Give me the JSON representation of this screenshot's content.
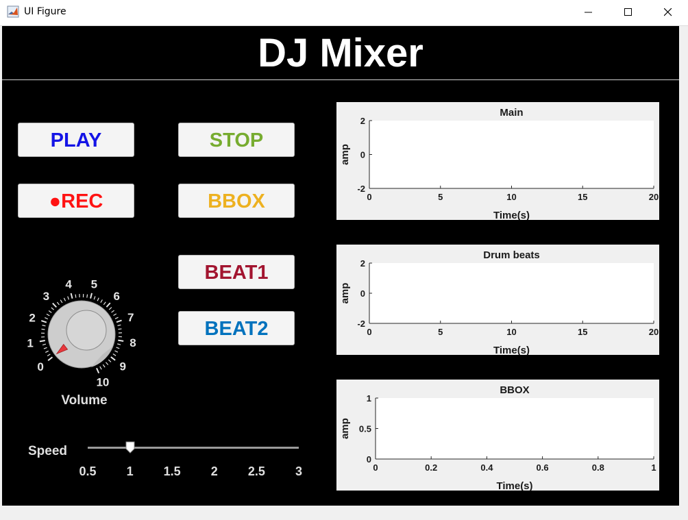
{
  "window": {
    "title": "UI Figure",
    "icon": "matlab-icon",
    "controls": [
      "minimize-icon",
      "maximize-icon",
      "close-icon"
    ]
  },
  "header": {
    "title": "DJ Mixer"
  },
  "buttons": {
    "play": {
      "label": "PLAY",
      "color": "#1414e6"
    },
    "stop": {
      "label": "STOP",
      "color": "#77ac30"
    },
    "rec": {
      "label": "●REC",
      "color": "#ff1212"
    },
    "bbox": {
      "label": "BBOX",
      "color": "#edb120"
    },
    "beat1": {
      "label": "BEAT1",
      "color": "#a2142f"
    },
    "beat2": {
      "label": "BEAT2",
      "color": "#0072bd"
    }
  },
  "volume_knob": {
    "label": "Volume",
    "ticks": [
      "0",
      "1",
      "2",
      "3",
      "4",
      "5",
      "6",
      "7",
      "8",
      "9",
      "10"
    ],
    "min": 0,
    "max": 10,
    "value": 0
  },
  "speed_slider": {
    "label": "Speed",
    "ticks": [
      "0.5",
      "1",
      "1.5",
      "2",
      "2.5",
      "3"
    ],
    "min": 0.5,
    "max": 3,
    "value": 1
  },
  "plots": [
    {
      "title": "Main",
      "xlabel": "Time(s)",
      "ylabel": "amp",
      "xlim": [
        0,
        20
      ],
      "ylim": [
        -2,
        2
      ],
      "xticks": [
        "0",
        "5",
        "10",
        "15",
        "20"
      ],
      "yticks": [
        "2",
        "0",
        "-2"
      ]
    },
    {
      "title": "Drum beats",
      "xlabel": "Time(s)",
      "ylabel": "amp",
      "xlim": [
        0,
        20
      ],
      "ylim": [
        -2,
        2
      ],
      "xticks": [
        "0",
        "5",
        "10",
        "15",
        "20"
      ],
      "yticks": [
        "2",
        "0",
        "-2"
      ]
    },
    {
      "title": "BBOX",
      "xlabel": "Time(s)",
      "ylabel": "amp",
      "xlim": [
        0,
        1
      ],
      "ylim": [
        0,
        1
      ],
      "xticks": [
        "0",
        "0.2",
        "0.4",
        "0.6",
        "0.8",
        "1"
      ],
      "yticks": [
        "1",
        "0.5",
        "0"
      ]
    }
  ]
}
